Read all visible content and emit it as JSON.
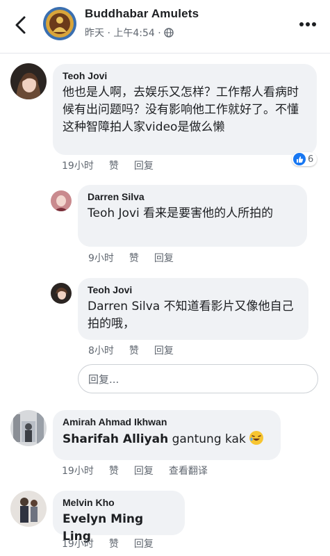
{
  "header": {
    "title": "Buddhabar Amulets",
    "meta": "昨天 · 上午4:54 ·"
  },
  "comments": [
    {
      "author": "Teoh Jovi",
      "text": "他也是人啊，去娱乐又怎样？工作帮人看病时候有出问题吗？没有影响他工作就好了。不懂这种智障拍人家video是做么懒",
      "time": "19小时",
      "like_label": "赞",
      "reply_label": "回复",
      "reaction_count": "6",
      "replies": [
        {
          "author": "Darren Silva",
          "text": "Teoh Jovi 看来是要害他的人所拍的",
          "time": "9小时",
          "like_label": "赞",
          "reply_label": "回复"
        },
        {
          "author": "Teoh Jovi",
          "text": "Darren Silva 不知道看影片又像他自己拍的哦，",
          "time": "8小时",
          "like_label": "赞",
          "reply_label": "回复"
        }
      ],
      "reply_placeholder": "回复..."
    },
    {
      "author": "Amirah Ahmad Ikhwan",
      "mention": "Sharifah Alliyah",
      "text": " gantung kak",
      "time": "19小时",
      "like_label": "赞",
      "reply_label": "回复",
      "translate_label": "查看翻译"
    },
    {
      "author": "Melvin Kho",
      "mention": "Evelyn Ming Ling",
      "time": "19小时",
      "like_label": "赞",
      "reply_label": "回复"
    }
  ],
  "colors": {
    "bubble": "#f0f2f5",
    "meta_text": "#606770",
    "like_blue": "#1877f2"
  },
  "icons": [
    "back-chevron-icon",
    "globe-icon",
    "more-dots-icon",
    "like-reaction-icon",
    "laughing-emoji-icon"
  ]
}
